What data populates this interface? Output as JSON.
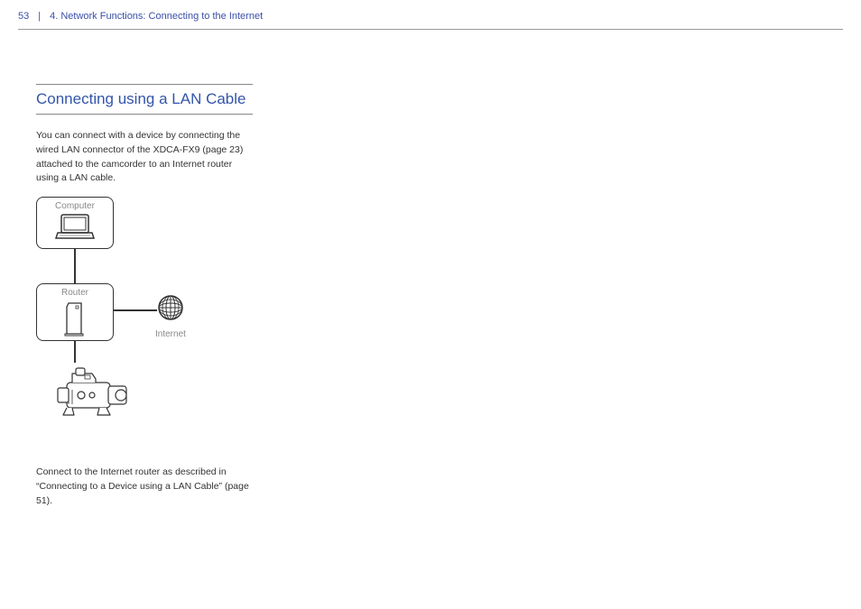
{
  "header": {
    "page_number": "53",
    "chapter_title": "4. Network Functions: Connecting to the Internet"
  },
  "section": {
    "title": "Connecting using a LAN Cable",
    "intro": "You can connect with a device by connecting the wired LAN connector of the XDCA-FX9 (page 23) attached to the camcorder to an Internet router using a LAN cable.",
    "outro": "Connect to the Internet router as described in “Connecting to a Device using a LAN Cable” (page 51)."
  },
  "diagram": {
    "computer_label": "Computer",
    "router_label": "Router",
    "internet_label": "Internet"
  }
}
